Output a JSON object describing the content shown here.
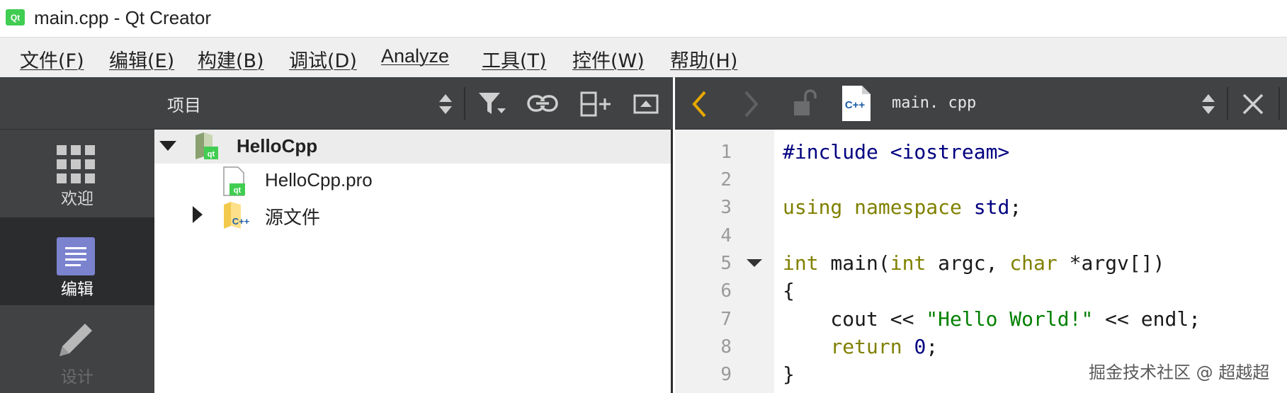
{
  "window": {
    "title": "main.cpp - Qt Creator",
    "app_icon_text": "Qt"
  },
  "menu": [
    "文件(F)",
    "编辑(E)",
    "构建(B)",
    "调试(D)",
    "Analyze",
    "工具(T)",
    "控件(W)",
    "帮助(H)"
  ],
  "modes": [
    {
      "label": "欢迎",
      "icon": "grid-icon",
      "active": false
    },
    {
      "label": "编辑",
      "icon": "edit-document-icon",
      "active": true
    },
    {
      "label": "设计",
      "icon": "pencil-icon",
      "active": false
    }
  ],
  "project_panel": {
    "title": "项目",
    "tree": [
      {
        "label": "HelloCpp",
        "bold": true,
        "expanded": true
      },
      {
        "label": "HelloCpp.pro",
        "bold": false
      },
      {
        "label": "源文件",
        "bold": false,
        "expanded": false
      }
    ]
  },
  "editor": {
    "file_name": "main. cpp",
    "file_icon_text": "C++",
    "line_numbers": [
      "1",
      "2",
      "3",
      "4",
      "5",
      "6",
      "7",
      "8",
      "9"
    ],
    "lines": [
      "#include <iostream>",
      "",
      "using namespace std;",
      "",
      "int main(int argc, char *argv[])",
      "{",
      "    cout << \"Hello World!\" << endl;",
      "    return 0;",
      "}"
    ]
  },
  "watermark": "掘金技术社区 @ 超越超",
  "colors": {
    "keyword": "#808000",
    "preprocessor": "#000080",
    "string": "#008000",
    "sidebar": "#404244",
    "edit_accent": "#7b83cf",
    "nav_back_active": "#e8a800"
  }
}
